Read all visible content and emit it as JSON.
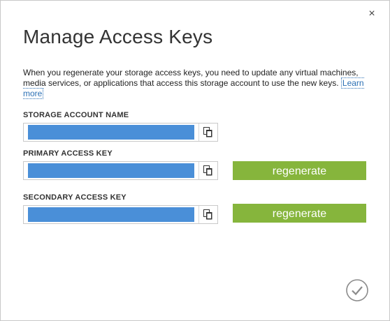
{
  "dialog": {
    "title": "Manage Access Keys",
    "close_glyph": "×",
    "description": "When you regenerate your storage access keys, you need to update any virtual machines, media services, or applications that access this storage account to use the new keys. ",
    "learn_more": "Learn more"
  },
  "fields": {
    "storage_account_name": {
      "label": "STORAGE ACCOUNT NAME",
      "value": ""
    },
    "primary_access_key": {
      "label": "PRIMARY ACCESS KEY",
      "value": ""
    },
    "secondary_access_key": {
      "label": "SECONDARY ACCESS KEY",
      "value": ""
    }
  },
  "buttons": {
    "regenerate_primary": "regenerate",
    "regenerate_secondary": "regenerate"
  },
  "icons": {
    "close": "close-icon",
    "copy": "copy-icon",
    "confirm": "checkmark-icon"
  },
  "colors": {
    "accent_green": "#86b53c",
    "redacted_blue": "#4a8fd8"
  }
}
